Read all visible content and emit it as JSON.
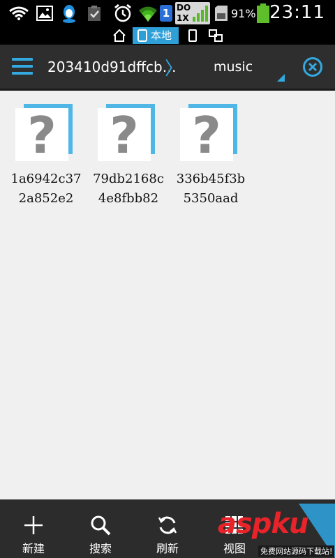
{
  "status_bar": {
    "sim_number": "1",
    "network_line1": "DO",
    "network_line2": "1X",
    "battery_percent": "91%",
    "time": "23:11"
  },
  "location_bar": {
    "active_label": "本地"
  },
  "header": {
    "path": "203410d91dffcb…",
    "folder": "music"
  },
  "files": [
    {
      "name": "1a6942c372a852e2"
    },
    {
      "name": "79db2168c4e8fbb82"
    },
    {
      "name": "336b45f3b5350aad"
    }
  ],
  "toolbar": {
    "new_label": "新建",
    "search_label": "搜索",
    "refresh_label": "刷新",
    "view_label": "视图"
  },
  "watermark": {
    "brand": "aspku",
    "tagline": "免费网站源码下载站!"
  },
  "colors": {
    "accent": "#33a9e0",
    "header_bg": "#2e2e2e",
    "toolbar_bg": "#2c2c2c",
    "content_bg": "#f0f0f0"
  }
}
